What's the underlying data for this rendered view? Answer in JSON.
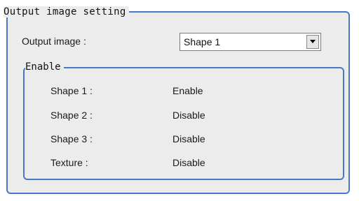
{
  "panel": {
    "title": "Output image setting"
  },
  "output_image": {
    "label": "Output image :",
    "selected_value": "Shape 1"
  },
  "enable_group": {
    "title": "Enable",
    "rows": [
      {
        "label": "Shape 1 :",
        "value": "Enable"
      },
      {
        "label": "Shape 2 :",
        "value": "Disable"
      },
      {
        "label": "Shape 3 :",
        "value": "Disable"
      },
      {
        "label": "Texture :",
        "value": "Disable"
      }
    ]
  },
  "colors": {
    "frame_border": "#4a78c8",
    "panel_background": "#ececec"
  },
  "icons": {
    "dropdown": "chevron-down-icon"
  }
}
